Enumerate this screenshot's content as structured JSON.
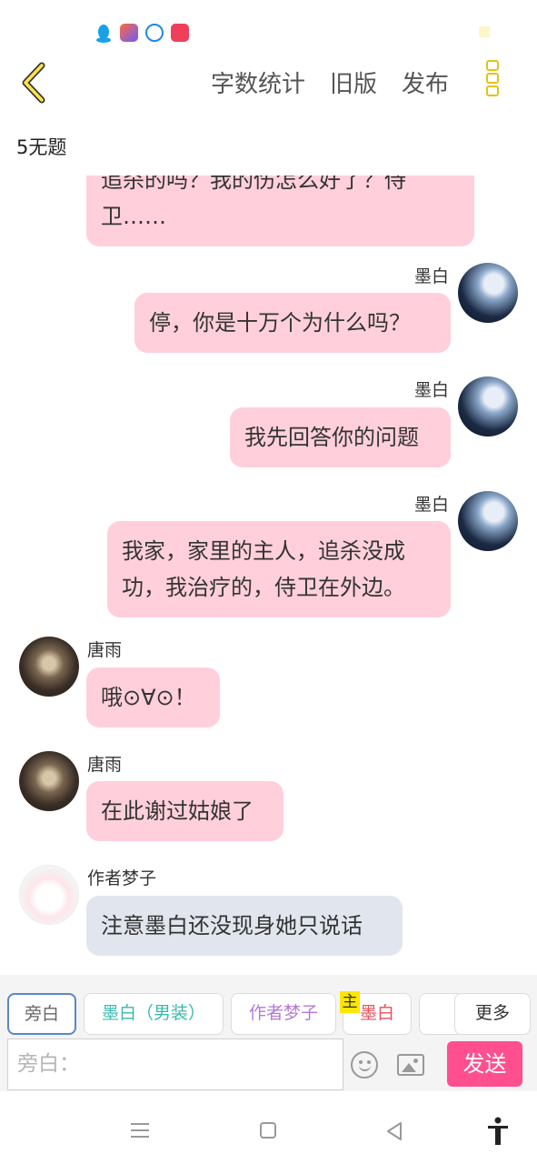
{
  "header": {
    "stats_label": "字数统计",
    "old_label": "旧版",
    "publish_label": "发布"
  },
  "story_title": "5无题",
  "colors": {
    "bubble_pink": "#ffd0db",
    "bubble_grey": "#e1e6ee",
    "send": "#ff4f8e",
    "accent_yellow": "#e3c318"
  },
  "messages": [
    {
      "side": "left",
      "speaker": "",
      "text_lines": [
        "追杀的吗？我的伤怎么好了？侍",
        "卫……"
      ]
    },
    {
      "side": "right",
      "speaker": "墨白",
      "text": "停，你是十万个为什么吗？"
    },
    {
      "side": "right",
      "speaker": "墨白",
      "text": "我先回答你的问题"
    },
    {
      "side": "right",
      "speaker": "墨白",
      "text_lines": [
        "我家，家里的主人，追杀没成",
        "功，我治疗的，侍卫在外边。"
      ]
    },
    {
      "side": "left",
      "speaker": "唐雨",
      "text": "哦⊙∀⊙！"
    },
    {
      "side": "left",
      "speaker": "唐雨",
      "text": "在此谢过姑娘了"
    },
    {
      "side": "left",
      "speaker": "作者梦子",
      "text": "注意墨白还没现身她只说话"
    }
  ],
  "characters": {
    "chips": [
      "旁白",
      "墨白（男装）",
      "作者梦子",
      "墨白",
      "（"
    ],
    "main_badge": "主",
    "more_label": "更多"
  },
  "composer": {
    "placeholder": "旁白：",
    "send_label": "发送"
  },
  "icons": [
    "back-icon",
    "more-vertical-icon",
    "emoji-icon",
    "image-icon",
    "menu-icon",
    "home-icon",
    "back-triangle-icon",
    "accessibility-icon"
  ]
}
